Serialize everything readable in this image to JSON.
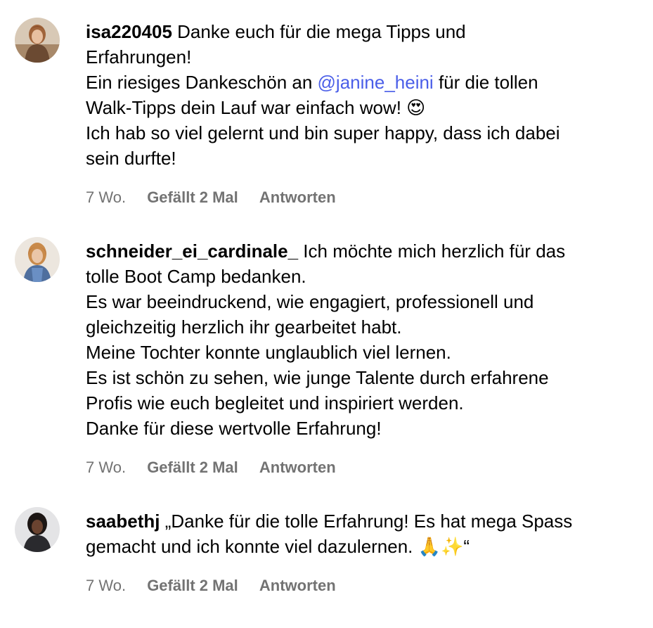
{
  "comments": [
    {
      "username": "isa220405",
      "avatar_icon": "profile-photo-1",
      "first_line": "Danke euch für die mega Tipps und",
      "line_2": "Erfahrungen!",
      "line_3_pre": "Ein riesiges Dankeschön an ",
      "mention": "@janine_heini",
      "line_3_post": " für die tollen",
      "line_4": "Walk-Tipps dein Lauf war einfach wow! 😍",
      "line_5": "Ich hab so viel gelernt und bin super happy, dass ich dabei",
      "line_6": "sein durfte!",
      "time": "7 Wo.",
      "likes": "Gefällt 2 Mal",
      "reply": "Antworten"
    },
    {
      "username": "schneider_ei_cardinale_",
      "avatar_icon": "profile-photo-2",
      "first_line": "Ich möchte mich herzlich für das",
      "line_2": "tolle Boot Camp bedanken.",
      "line_3": "Es war beeindruckend, wie engagiert, professionell und",
      "line_4": "gleichzeitig herzlich ihr gearbeitet habt.",
      "line_5": "Meine Tochter konnte unglaublich viel lernen.",
      "line_6": "Es ist schön zu sehen, wie junge Talente durch erfahrene",
      "line_7": "Profis wie euch begleitet und inspiriert werden.",
      "line_8": "Danke für diese wertvolle Erfahrung!",
      "time": "7 Wo.",
      "likes": "Gefällt 2 Mal",
      "reply": "Antworten"
    },
    {
      "username": "saabethj",
      "avatar_icon": "profile-photo-3",
      "first_line": "„Danke für die tolle Erfahrung! Es hat mega Spass",
      "line_2": "gemacht und ich konnte viel dazulernen. 🙏✨“",
      "time": "7 Wo.",
      "likes": "Gefällt 2 Mal",
      "reply": "Antworten"
    }
  ]
}
